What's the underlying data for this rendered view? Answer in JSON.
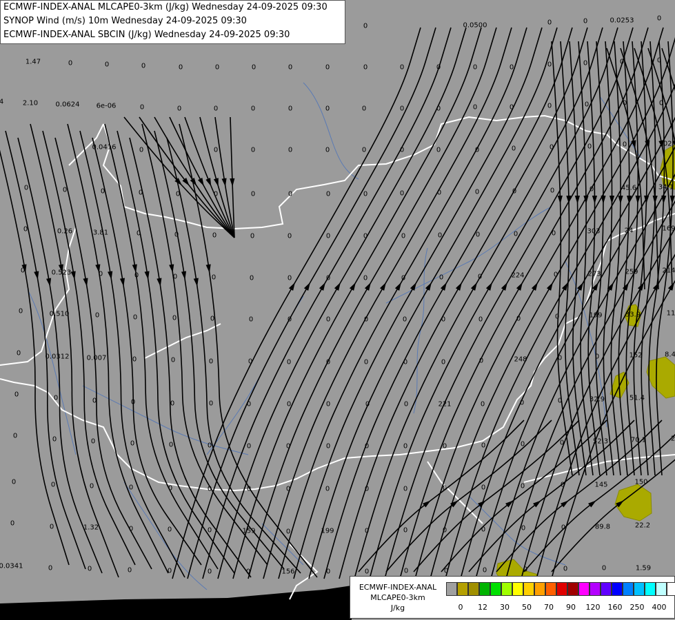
{
  "titles": [
    "ECMWF-INDEX-ANAL MLCAPE0-3km (J/kg) Wednesday 24-09-2025 09:30",
    "SYNOP Wind (m/s) 10m Wednesday 24-09-2025 09:30",
    "ECMWF-INDEX-ANAL SBCIN (J/kg) Wednesday 24-09-2025 09:30"
  ],
  "legend": {
    "line1": "ECMWF-INDEX-ANAL",
    "line2": "MLCAPE0-3km",
    "unit": "J/kg",
    "colors": [
      "#a0a0a0",
      "#b4a000",
      "#a09000",
      "#00b400",
      "#00e000",
      "#a0ff00",
      "#ffff00",
      "#ffd000",
      "#ffa000",
      "#ff6000",
      "#e00000",
      "#a00000",
      "#ff00ff",
      "#b400ff",
      "#6000ff",
      "#0000ff",
      "#0080ff",
      "#00c0ff",
      "#00ffff",
      "#c0ffff",
      "#ffffff"
    ],
    "ticks": [
      "0",
      "12",
      "30",
      "50",
      "70",
      "90",
      "120",
      "160",
      "250",
      "400"
    ]
  },
  "colors": {
    "background": "#9b9b9b",
    "border": "#ffffff",
    "river": "#5a7ab4",
    "cape_fill": "#aaaa00",
    "streamline": "#000000"
  },
  "values": [
    [
      "0",
      530,
      38
    ],
    [
      "0.0500",
      689,
      37
    ],
    [
      "0",
      797,
      33
    ],
    [
      "0",
      849,
      31
    ],
    [
      "0.0253",
      902,
      30
    ],
    [
      "0",
      956,
      27
    ],
    [
      "1.47",
      48,
      90
    ],
    [
      "0",
      102,
      92
    ],
    [
      "0",
      155,
      94
    ],
    [
      "0",
      208,
      96
    ],
    [
      "0",
      262,
      98
    ],
    [
      "0",
      315,
      98
    ],
    [
      "0",
      368,
      98
    ],
    [
      "0",
      421,
      98
    ],
    [
      "0",
      475,
      98
    ],
    [
      "0",
      530,
      98
    ],
    [
      "0",
      583,
      98
    ],
    [
      "0",
      636,
      98
    ],
    [
      "0",
      689,
      98
    ],
    [
      "0",
      742,
      98
    ],
    [
      "0",
      797,
      94
    ],
    [
      "0",
      849,
      92
    ],
    [
      "0",
      902,
      90
    ],
    [
      "0",
      956,
      88
    ],
    [
      "4",
      2,
      148
    ],
    [
      "2.10",
      44,
      150
    ],
    [
      "0.0624",
      98,
      152
    ],
    [
      "6e-06",
      154,
      154
    ],
    [
      "0",
      206,
      156
    ],
    [
      "0",
      260,
      158
    ],
    [
      "0",
      313,
      158
    ],
    [
      "0",
      367,
      158
    ],
    [
      "0",
      421,
      158
    ],
    [
      "0",
      475,
      158
    ],
    [
      "0",
      528,
      158
    ],
    [
      "0",
      583,
      158
    ],
    [
      "0",
      636,
      158
    ],
    [
      "0",
      689,
      156
    ],
    [
      "0",
      742,
      156
    ],
    [
      "0",
      797,
      154
    ],
    [
      "0",
      851,
      152
    ],
    [
      "0",
      906,
      150
    ],
    [
      "0",
      959,
      150
    ],
    [
      "0.0416",
      151,
      214
    ],
    [
      "0",
      205,
      218
    ],
    [
      "0",
      313,
      218
    ],
    [
      "0",
      367,
      218
    ],
    [
      "0",
      421,
      218
    ],
    [
      "0",
      475,
      218
    ],
    [
      "0",
      528,
      218
    ],
    [
      "0",
      583,
      218
    ],
    [
      "0",
      636,
      218
    ],
    [
      "0",
      692,
      218
    ],
    [
      "0",
      745,
      216
    ],
    [
      "0",
      800,
      214
    ],
    [
      "0",
      855,
      213
    ],
    [
      "0",
      906,
      210
    ],
    [
      "102",
      965,
      209
    ],
    [
      "0",
      38,
      273
    ],
    [
      "0",
      94,
      276
    ],
    [
      "0",
      149,
      278
    ],
    [
      "0",
      204,
      280
    ],
    [
      "0",
      258,
      282
    ],
    [
      "0",
      313,
      282
    ],
    [
      "0",
      367,
      282
    ],
    [
      "0",
      421,
      282
    ],
    [
      "0",
      476,
      282
    ],
    [
      "0",
      530,
      282
    ],
    [
      "0",
      583,
      281
    ],
    [
      "0",
      637,
      280
    ],
    [
      "0",
      692,
      279
    ],
    [
      "0",
      746,
      278
    ],
    [
      "0",
      801,
      277
    ],
    [
      "0",
      858,
      275
    ],
    [
      "45.6",
      912,
      273
    ],
    [
      "34.1",
      966,
      272
    ],
    [
      "0",
      37,
      333
    ],
    [
      "0.26",
      94,
      336
    ],
    [
      "3.81",
      146,
      338
    ],
    [
      "0",
      201,
      339
    ],
    [
      "0",
      256,
      341
    ],
    [
      "0",
      311,
      342
    ],
    [
      "0",
      366,
      343
    ],
    [
      "0",
      420,
      343
    ],
    [
      "0",
      476,
      343
    ],
    [
      "0",
      530,
      343
    ],
    [
      "0",
      585,
      343
    ],
    [
      "0",
      638,
      342
    ],
    [
      "0",
      693,
      341
    ],
    [
      "0",
      748,
      340
    ],
    [
      "0",
      803,
      339
    ],
    [
      "303",
      861,
      336
    ],
    [
      "24",
      912,
      335
    ],
    [
      "169",
      970,
      332
    ],
    [
      "0",
      33,
      393
    ],
    [
      "0.523",
      89,
      396
    ],
    [
      "0",
      146,
      398
    ],
    [
      "0",
      198,
      400
    ],
    [
      "0",
      254,
      402
    ],
    [
      "0",
      310,
      403
    ],
    [
      "0",
      365,
      404
    ],
    [
      "0",
      420,
      404
    ],
    [
      "0",
      476,
      404
    ],
    [
      "0",
      530,
      404
    ],
    [
      "0",
      585,
      404
    ],
    [
      "0",
      640,
      403
    ],
    [
      "0",
      696,
      402
    ],
    [
      "224",
      751,
      400
    ],
    [
      "0",
      806,
      399
    ],
    [
      "273",
      862,
      398
    ],
    [
      "259",
      916,
      395
    ],
    [
      "214",
      970,
      393
    ],
    [
      "0",
      30,
      452
    ],
    [
      "0.510",
      86,
      456
    ],
    [
      "0",
      141,
      458
    ],
    [
      "0",
      196,
      461
    ],
    [
      "0",
      253,
      462
    ],
    [
      "0",
      308,
      463
    ],
    [
      "0",
      364,
      464
    ],
    [
      "0",
      420,
      464
    ],
    [
      "0",
      476,
      464
    ],
    [
      "0",
      531,
      464
    ],
    [
      "0",
      587,
      464
    ],
    [
      "0",
      643,
      464
    ],
    [
      "0",
      697,
      464
    ],
    [
      "0",
      752,
      463
    ],
    [
      "0",
      808,
      460
    ],
    [
      "199",
      864,
      458
    ],
    [
      "33.9",
      918,
      457
    ],
    [
      "11",
      973,
      455
    ],
    [
      "0",
      27,
      513
    ],
    [
      "0.0312",
      83,
      518
    ],
    [
      "0.007",
      140,
      520
    ],
    [
      "0",
      195,
      522
    ],
    [
      "0",
      251,
      523
    ],
    [
      "0",
      306,
      525
    ],
    [
      "0",
      363,
      525
    ],
    [
      "0",
      419,
      526
    ],
    [
      "0",
      476,
      526
    ],
    [
      "0",
      531,
      526
    ],
    [
      "0",
      588,
      526
    ],
    [
      "0",
      643,
      526
    ],
    [
      "0",
      698,
      524
    ],
    [
      "248",
      755,
      522
    ],
    [
      "0",
      812,
      520
    ],
    [
      "0",
      866,
      518
    ],
    [
      "152",
      922,
      516
    ],
    [
      "8.4",
      972,
      515
    ],
    [
      "0",
      24,
      573
    ],
    [
      "0",
      81,
      578
    ],
    [
      "0",
      137,
      582
    ],
    [
      "0",
      193,
      584
    ],
    [
      "0",
      250,
      586
    ],
    [
      "0",
      306,
      586
    ],
    [
      "0",
      361,
      587
    ],
    [
      "0",
      419,
      587
    ],
    [
      "0",
      476,
      587
    ],
    [
      "0",
      533,
      587
    ],
    [
      "0",
      589,
      587
    ],
    [
      "221",
      645,
      587
    ],
    [
      "0",
      700,
      587
    ],
    [
      "0",
      757,
      585
    ],
    [
      "0",
      812,
      582
    ],
    [
      "32.9",
      866,
      580
    ],
    [
      "51.4",
      924,
      578
    ],
    [
      "0",
      22,
      633
    ],
    [
      "0",
      79,
      638
    ],
    [
      "0",
      135,
      641
    ],
    [
      "0",
      192,
      644
    ],
    [
      "0",
      248,
      646
    ],
    [
      "0",
      304,
      647
    ],
    [
      "0",
      361,
      648
    ],
    [
      "0",
      418,
      648
    ],
    [
      "0",
      476,
      648
    ],
    [
      "0",
      532,
      648
    ],
    [
      "0",
      588,
      648
    ],
    [
      "0",
      645,
      648
    ],
    [
      "0",
      701,
      647
    ],
    [
      "0",
      758,
      645
    ],
    [
      "0",
      815,
      643
    ],
    [
      "52.3",
      871,
      641
    ],
    [
      "70.1",
      926,
      639
    ],
    [
      "2",
      976,
      637
    ],
    [
      "0",
      20,
      700
    ],
    [
      "0",
      77,
      704
    ],
    [
      "0",
      133,
      706
    ],
    [
      "0",
      190,
      708
    ],
    [
      "0",
      247,
      709
    ],
    [
      "0",
      304,
      710
    ],
    [
      "0",
      361,
      710
    ],
    [
      "0",
      418,
      710
    ],
    [
      "0",
      475,
      710
    ],
    [
      "0",
      532,
      710
    ],
    [
      "0",
      588,
      710
    ],
    [
      "0",
      645,
      709
    ],
    [
      "0",
      701,
      708
    ],
    [
      "0",
      758,
      706
    ],
    [
      "0",
      816,
      704
    ],
    [
      "145",
      872,
      704
    ],
    [
      "150",
      930,
      700
    ],
    [
      "0",
      18,
      760
    ],
    [
      "0",
      75,
      765
    ],
    [
      "1.32",
      132,
      766
    ],
    [
      "0",
      190,
      768
    ],
    [
      "0",
      246,
      769
    ],
    [
      "0",
      304,
      770
    ],
    [
      "159",
      361,
      771
    ],
    [
      "0",
      418,
      772
    ],
    [
      "199",
      475,
      771
    ],
    [
      "0",
      532,
      771
    ],
    [
      "0",
      588,
      770
    ],
    [
      "0",
      645,
      770
    ],
    [
      "0",
      701,
      769
    ],
    [
      "0",
      759,
      767
    ],
    [
      "0",
      817,
      766
    ],
    [
      "89.8",
      874,
      765
    ],
    [
      "22.2",
      932,
      763
    ],
    [
      "0.0341",
      16,
      822
    ],
    [
      "0",
      73,
      825
    ],
    [
      "0",
      130,
      826
    ],
    [
      "0",
      188,
      828
    ],
    [
      "0",
      246,
      829
    ],
    [
      "0",
      304,
      830
    ],
    [
      "0",
      360,
      830
    ],
    [
      "156",
      418,
      830
    ],
    [
      "0",
      476,
      830
    ],
    [
      "0",
      532,
      830
    ],
    [
      "0",
      589,
      829
    ],
    [
      "0",
      647,
      829
    ],
    [
      "0",
      703,
      828
    ],
    [
      "0",
      762,
      827
    ],
    [
      "0",
      820,
      826
    ],
    [
      "0",
      876,
      825
    ],
    [
      "1.59",
      933,
      825
    ]
  ]
}
